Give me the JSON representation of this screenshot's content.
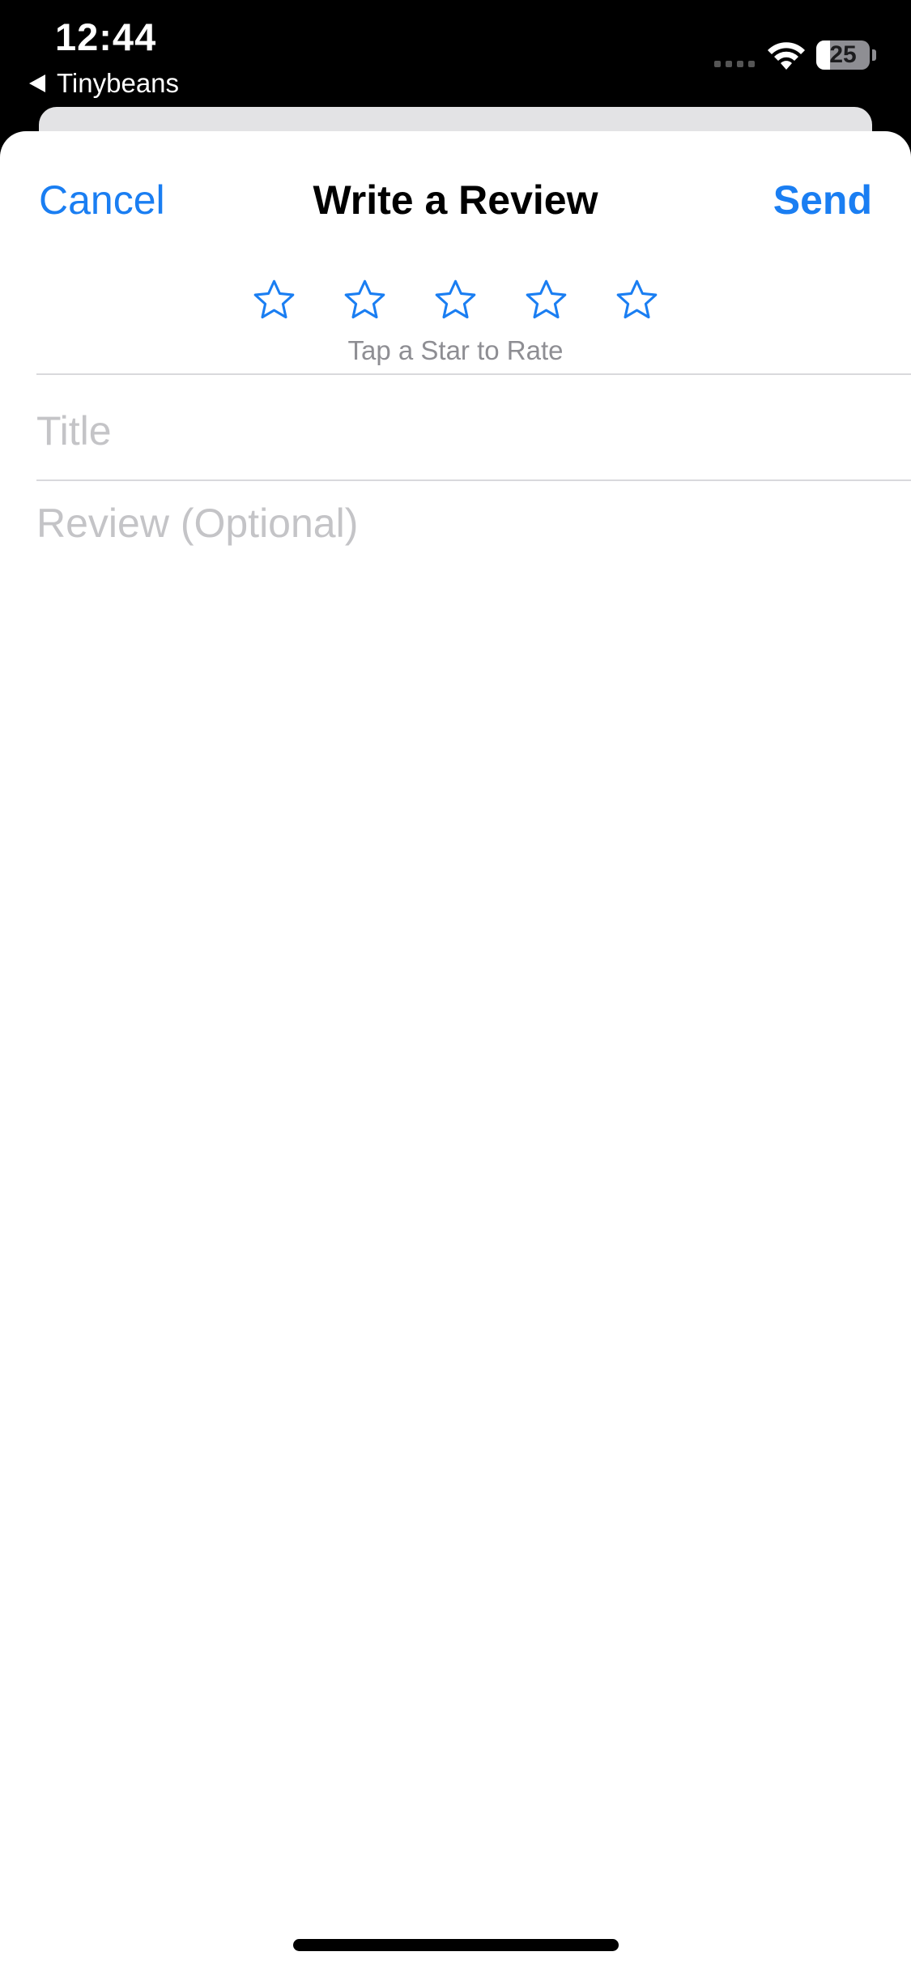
{
  "status_bar": {
    "time": "12:44",
    "back_app": "Tinybeans",
    "battery": {
      "label": "25",
      "level": 0.25
    },
    "icons": [
      "cellular-signal-icon",
      "wifi-icon",
      "battery-icon"
    ]
  },
  "sheet": {
    "cancel_label": "Cancel",
    "title": "Write a Review",
    "send_label": "Send",
    "rating": {
      "stars": 5,
      "selected": 0,
      "hint": "Tap a Star to Rate",
      "star_icon": "star-outline-icon"
    },
    "title_field": {
      "placeholder": "Title",
      "value": ""
    },
    "review_field": {
      "placeholder": "Review (Optional)",
      "value": ""
    }
  },
  "colors": {
    "accent": "#1a7ef2",
    "placeholder": "#c4c4c7",
    "hint": "#8e8e93",
    "background": "#ffffff",
    "status_bar": "#000000"
  }
}
